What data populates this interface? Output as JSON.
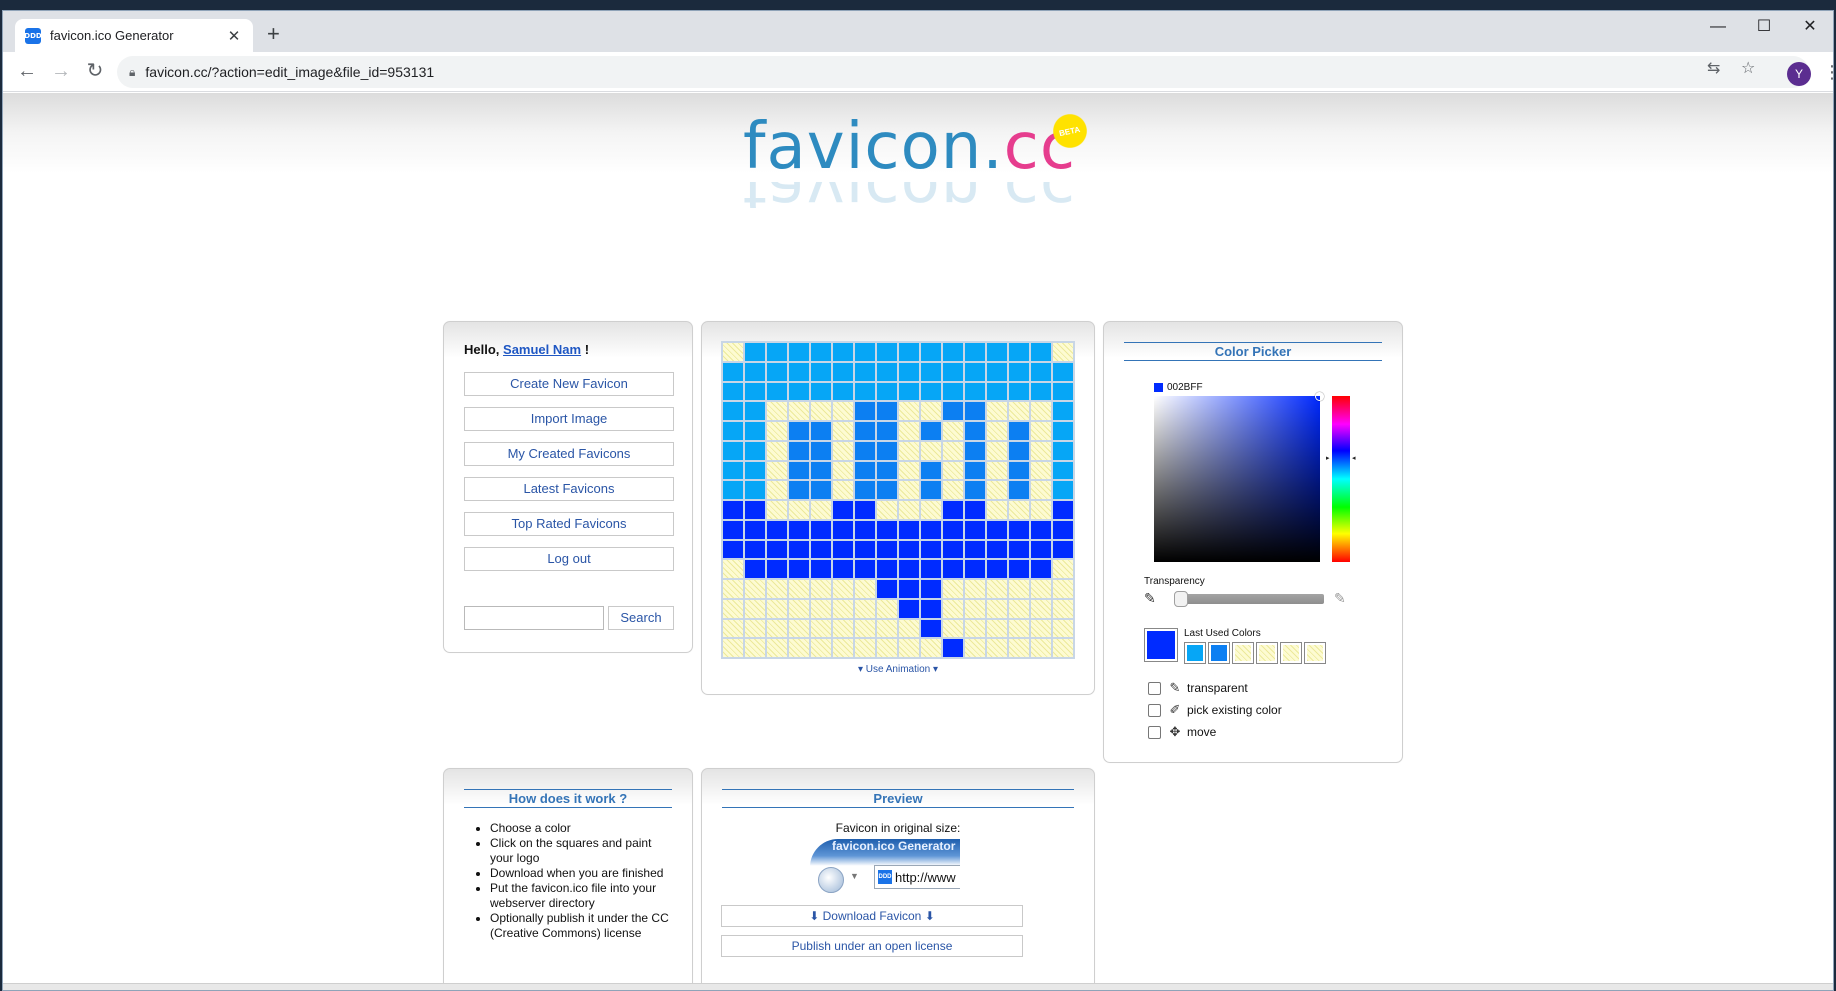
{
  "browser": {
    "tab_title": "favicon.ico Generator",
    "tab_favicon_text": "DDD",
    "url": "favicon.cc/?action=edit_image&file_id=953131",
    "avatar_letter": "Y",
    "icons": [
      "back-icon",
      "forward-icon",
      "reload-icon",
      "lock-icon",
      "translate-icon",
      "star-icon",
      "menu-icon",
      "close-icon",
      "new-tab-icon",
      "minimize-icon",
      "maximize-icon"
    ]
  },
  "site": {
    "logo_main": "favicon.",
    "logo_accent": "cc",
    "beta_badge": "BETA"
  },
  "account": {
    "hello_prefix": "Hello,",
    "user_name": "Samuel Nam",
    "hello_suffix": "!",
    "menu": [
      {
        "label": "Create New Favicon"
      },
      {
        "label": "Import Image"
      },
      {
        "label": "My Created Favicons"
      },
      {
        "label": "Latest Favicons"
      },
      {
        "label": "Top Rated Favicons"
      },
      {
        "label": "Log out"
      }
    ],
    "search_button": "Search",
    "search_value": ""
  },
  "editor": {
    "use_animation": "▾ Use Animation ▾",
    "palette": {
      "0": "transparent",
      "1": "#06A6F6",
      "2": "#0C7FF2",
      "3": "#002BFF"
    },
    "pixels": [
      "0111111111111110",
      "1111111111111111",
      "1111111111111111",
      "1100002200220001",
      "1102202202020201",
      "1102202200020201",
      "1102202202020201",
      "1102202202020201",
      "3300033000330003",
      "3333333333333333",
      "3333333333333333",
      "0333333333333330",
      "0000000333000000",
      "0000000033000000",
      "0000000003000000",
      "0000000000300000"
    ]
  },
  "color_picker": {
    "title": "Color Picker",
    "hex_value": "002BFF",
    "current_color": "#002BFF",
    "transparency_label": "Transparency",
    "last_used_label": "Last Used Colors",
    "last_used": [
      "#06A6F6",
      "#0C7FF2",
      "transparent",
      "transparent",
      "transparent",
      "transparent"
    ],
    "options": [
      {
        "label": "transparent",
        "icon": "eraser-icon",
        "checked": false
      },
      {
        "label": "pick existing color",
        "icon": "eyedropper-icon",
        "checked": false
      },
      {
        "label": "move",
        "icon": "move-icon",
        "checked": false
      }
    ]
  },
  "how_it_works": {
    "title": "How does it work ?",
    "steps": [
      "Choose a color",
      "Click on the squares and paint your logo",
      "Download when you are finished",
      "Put the favicon.ico file into your webserver directory",
      "Optionally publish it under the CC (Creative Commons) license"
    ]
  },
  "preview": {
    "title": "Preview",
    "original_size_label": "Favicon in original size:",
    "browser_title_text": "favicon.ico Generator",
    "url_text": "http://www",
    "download_button": "⬇ Download Favicon ⬇",
    "publish_button": "Publish under an open license"
  }
}
